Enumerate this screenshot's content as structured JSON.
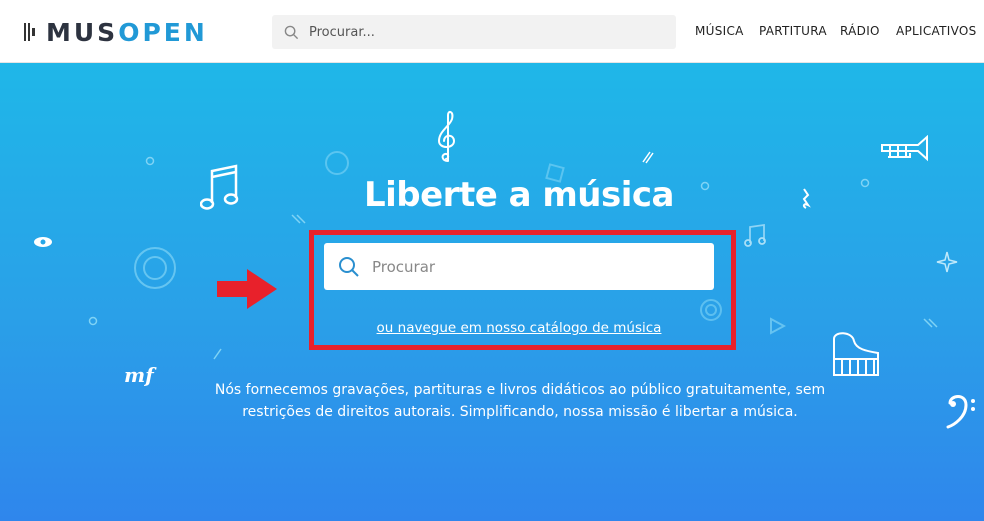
{
  "brand": {
    "logo_part1": "MUS",
    "logo_part2": "OPEN",
    "accent_color": "#2199d6",
    "dark_color": "#2d3340"
  },
  "header": {
    "search": {
      "placeholder": "Procurar..."
    },
    "nav": [
      "MÚSICA",
      "PARTITURA",
      "RÁDIO",
      "APLICATIVOS"
    ]
  },
  "hero": {
    "title": "Liberte a música",
    "search": {
      "placeholder": "Procurar"
    },
    "catalog_link": "ou navegue em nosso catálogo de música",
    "description": "Nós fornecemos gravações, partituras e livros didáticos ao público gratuitamente, sem restrições de direitos autorais. Simplificando, nossa missão é libertar a música.",
    "decor_text_mf": "mf",
    "highlight_color": "#e8212b"
  }
}
